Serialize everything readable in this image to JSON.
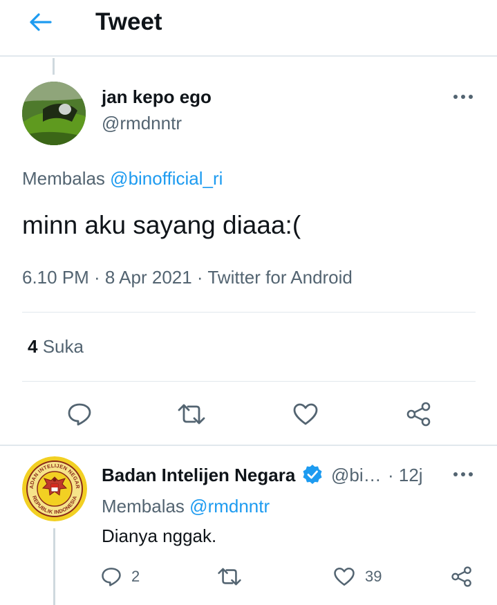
{
  "header": {
    "title": "Tweet",
    "back_icon": "arrow-left-icon"
  },
  "colors": {
    "accent": "#1d9bf0",
    "muted": "#536471",
    "divider": "#e1e8ed",
    "text": "#0f1419"
  },
  "tweet": {
    "author_name": "jan kepo ego",
    "author_handle": "@rmdnntr",
    "reply_prefix": "Membalas",
    "reply_to": "@binofficial_ri",
    "text": "minn aku sayang diaaa:(",
    "meta": "6.10 PM · 8 Apr 2021 · Twitter for Android",
    "likes_count": "4",
    "likes_label": "Suka",
    "actions": [
      "reply-icon",
      "retweet-icon",
      "like-icon",
      "share-icon"
    ]
  },
  "reply": {
    "author_name": "Badan Intelijen Negara",
    "author_handle": "@bi…",
    "time": "· 12j",
    "reply_prefix": "Membalas",
    "reply_to": "@rmdnntr",
    "text": "Dianya nggak.",
    "reply_count": "2",
    "like_count": "39",
    "logo_text_top": "BADAN INTELIJEN NEGARA",
    "logo_text_bottom": "REPUBLIK INDONESIA"
  }
}
